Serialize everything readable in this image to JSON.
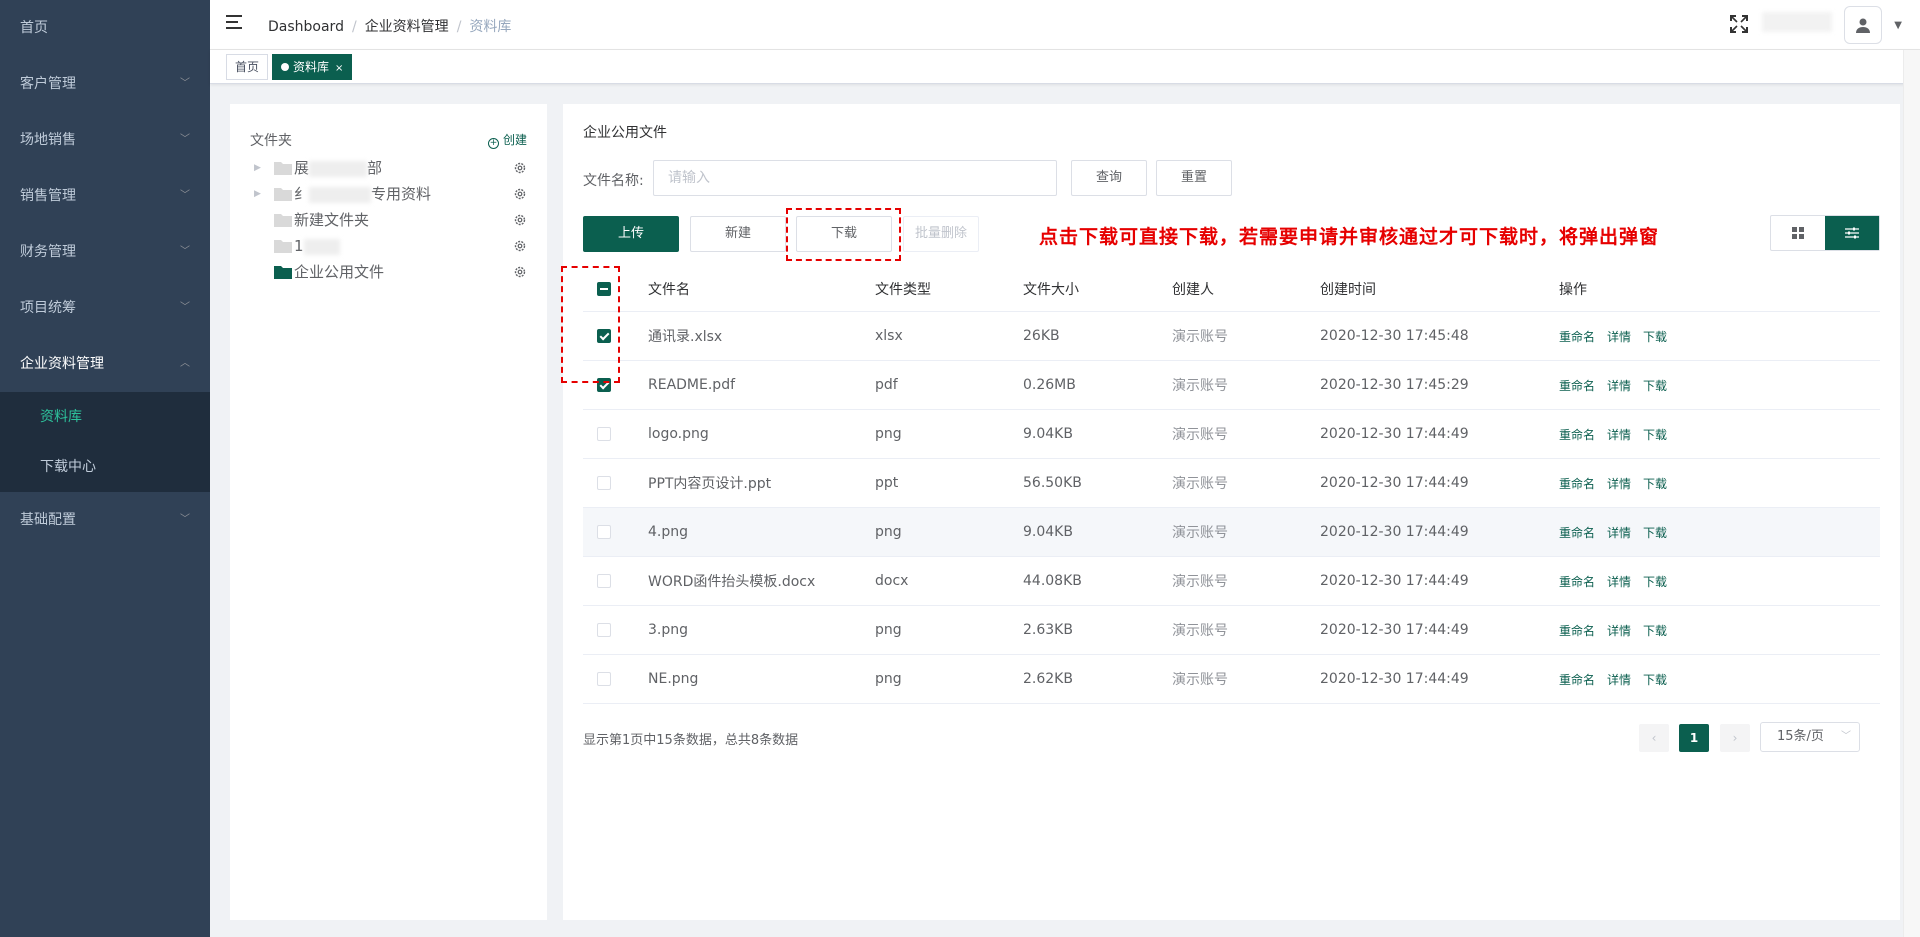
{
  "sidebar": {
    "items": [
      {
        "label": "首页"
      },
      {
        "label": "客户管理"
      },
      {
        "label": "场地销售"
      },
      {
        "label": "销售管理"
      },
      {
        "label": "财务管理"
      },
      {
        "label": "项目统筹"
      },
      {
        "label": "企业资料管理"
      },
      {
        "label": "基础配置"
      }
    ],
    "submenu": [
      {
        "label": "资料库"
      },
      {
        "label": "下载中心"
      }
    ]
  },
  "navbar": {
    "breadcrumb": [
      "Dashboard",
      "企业资料管理",
      "资料库"
    ]
  },
  "tags": [
    {
      "label": "首页"
    },
    {
      "label": "资料库",
      "close": "×"
    }
  ],
  "folders": {
    "header": "文件夹",
    "create_label": "创建",
    "nodes": [
      {
        "prefix": "展",
        "suffix": "部"
      },
      {
        "prefix": "纟",
        "suffix": "专用资料"
      },
      {
        "label": "新建文件夹"
      },
      {
        "prefix": "1",
        "suffix": ""
      },
      {
        "label": "企业公用文件"
      }
    ]
  },
  "main": {
    "title": "企业公用文件",
    "search_label": "文件名称:",
    "search_placeholder": "请输入",
    "query_label": "查询",
    "reset_label": "重置",
    "upload_label": "上传",
    "new_label": "新建",
    "download_label": "下载",
    "batch_delete_label": "批量删除",
    "annotation": "点击下载可直接下载，若需要申请并审核通过才可下载时，将弹出弹窗"
  },
  "table": {
    "headers": {
      "name": "文件名",
      "type": "文件类型",
      "size": "文件大小",
      "creator": "创建人",
      "time": "创建时间",
      "ops": "操作"
    },
    "ops": {
      "rename": "重命名",
      "detail": "详情",
      "download": "下载"
    },
    "rows": [
      {
        "name": "通讯录.xlsx",
        "type": "xlsx",
        "size": "26KB",
        "creator": "演示账号",
        "time": "2020-12-30 17:45:48",
        "checked": true
      },
      {
        "name": "README.pdf",
        "type": "pdf",
        "size": "0.26MB",
        "creator": "演示账号",
        "time": "2020-12-30 17:45:29",
        "checked": true
      },
      {
        "name": "logo.png",
        "type": "png",
        "size": "9.04KB",
        "creator": "演示账号",
        "time": "2020-12-30 17:44:49",
        "checked": false
      },
      {
        "name": "PPT内容页设计.ppt",
        "type": "ppt",
        "size": "56.50KB",
        "creator": "演示账号",
        "time": "2020-12-30 17:44:49",
        "checked": false
      },
      {
        "name": "4.png",
        "type": "png",
        "size": "9.04KB",
        "creator": "演示账号",
        "time": "2020-12-30 17:44:49",
        "checked": false
      },
      {
        "name": "WORD函件抬头模板.docx",
        "type": "docx",
        "size": "44.08KB",
        "creator": "演示账号",
        "time": "2020-12-30 17:44:49",
        "checked": false
      },
      {
        "name": "3.png",
        "type": "png",
        "size": "2.63KB",
        "creator": "演示账号",
        "time": "2020-12-30 17:44:49",
        "checked": false
      },
      {
        "name": "NE.png",
        "type": "png",
        "size": "2.62KB",
        "creator": "演示账号",
        "time": "2020-12-30 17:44:49",
        "checked": false
      }
    ]
  },
  "pagination": {
    "info": "显示第1页中15条数据，总共8条数据",
    "current_page": "1",
    "prev": "‹",
    "next": "›",
    "page_size": "15条/页"
  },
  "colors": {
    "sidebar_bg": "#304156",
    "primary": "#0b5f4f",
    "active_submenu": "#2dc19b",
    "annotation": "#e60000"
  }
}
